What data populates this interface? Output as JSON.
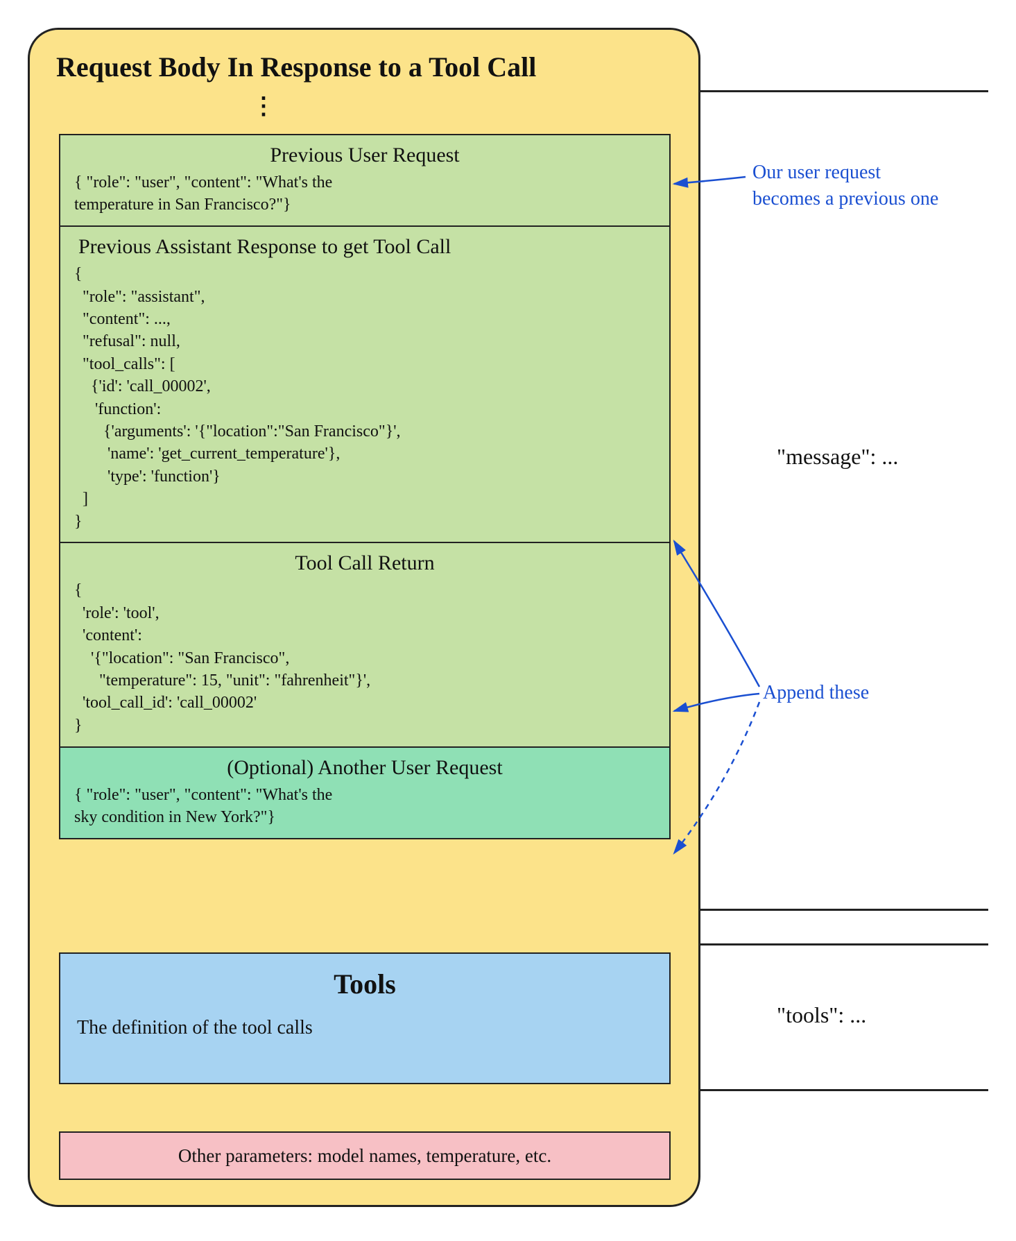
{
  "title": "Request Body In Response to a Tool Call",
  "dots": "⋮",
  "messages": {
    "prev_user": {
      "title": "Previous User Request",
      "code": "{ \"role\": \"user\", \"content\": \"What's the\ntemperature in San Francisco?\"}"
    },
    "prev_assistant": {
      "title": "Previous Assistant Response to get Tool Call",
      "code": "{\n  \"role\": \"assistant\",\n  \"content\": ...,\n  \"refusal\": null,\n  \"tool_calls\": [\n    {'id': 'call_00002',\n     'function':\n       {'arguments': '{\"location\":\"San Francisco\"}',\n        'name': 'get_current_temperature'},\n        'type': 'function'}\n  ]\n}"
    },
    "tool_return": {
      "title": "Tool Call Return",
      "code": "{\n  'role': 'tool',\n  'content':\n    '{\"location\": \"San Francisco\",\n      \"temperature\": 15, \"unit\": \"fahrenheit\"}',\n  'tool_call_id': 'call_00002'\n}"
    },
    "optional_user": {
      "title": "(Optional) Another User Request",
      "code": "{ \"role\": \"user\", \"content\": \"What's the\nsky condition in New York?\"}"
    }
  },
  "tools": {
    "title": "Tools",
    "desc": "The definition of the tool calls"
  },
  "params_text": "Other parameters: model names, temperature, etc.",
  "annotations": {
    "becomes_prev": "Our user request\nbecomes a previous one",
    "append_these": "Append these"
  },
  "key_labels": {
    "message": "\"message\": ...",
    "tools": "\"tools\": ..."
  }
}
